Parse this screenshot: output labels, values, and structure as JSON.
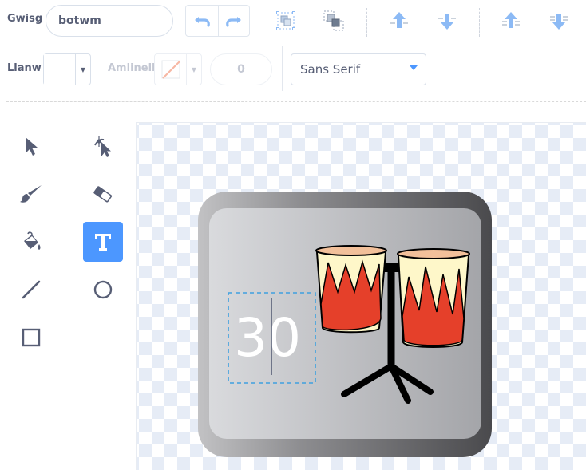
{
  "costume": {
    "label": "Gwisg",
    "name_value": "botwm"
  },
  "fill": {
    "label": "Llanw",
    "color": "#ffffff"
  },
  "outline": {
    "label": "Amlinell",
    "width_value": "0"
  },
  "font": {
    "selected": "Sans Serif"
  },
  "canvas": {
    "text_value": "30"
  },
  "colors": {
    "accent": "#4c97ff",
    "text": "#575e75",
    "disabled": "#c4c8d3"
  }
}
